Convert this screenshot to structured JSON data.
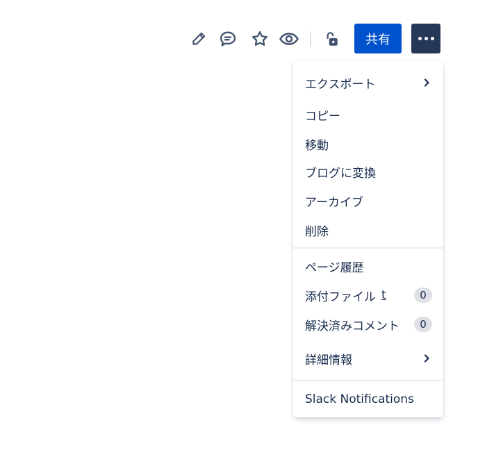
{
  "toolbar": {
    "edit_icon": "pencil-icon",
    "comment_icon": "comment-icon",
    "star_icon": "star-icon",
    "watch_icon": "eye-icon",
    "restrictions_icon": "unlocked-padlock-icon",
    "share_label": "共有",
    "more_icon": "more-horizontal-icon"
  },
  "menu": {
    "export_label": "エクスポート",
    "copy_label": "コピー",
    "move_label": "移動",
    "convert_label": "ブログに変換",
    "archive_label": "アーカイブ",
    "delete_label": "削除",
    "history_label": "ページ履歴",
    "attachments_label": "添付ファイル",
    "attachments_shortcut": "t",
    "attachments_count": "0",
    "resolved_label": "解決済みコメント",
    "resolved_count": "0",
    "details_label": "詳細情報",
    "slack_label": "Slack Notifications"
  },
  "colors": {
    "primary": "#0052CC",
    "more_button": "#253858",
    "text": "#172B4D",
    "icon": "#42526E",
    "badge": "#DFE1E6"
  }
}
